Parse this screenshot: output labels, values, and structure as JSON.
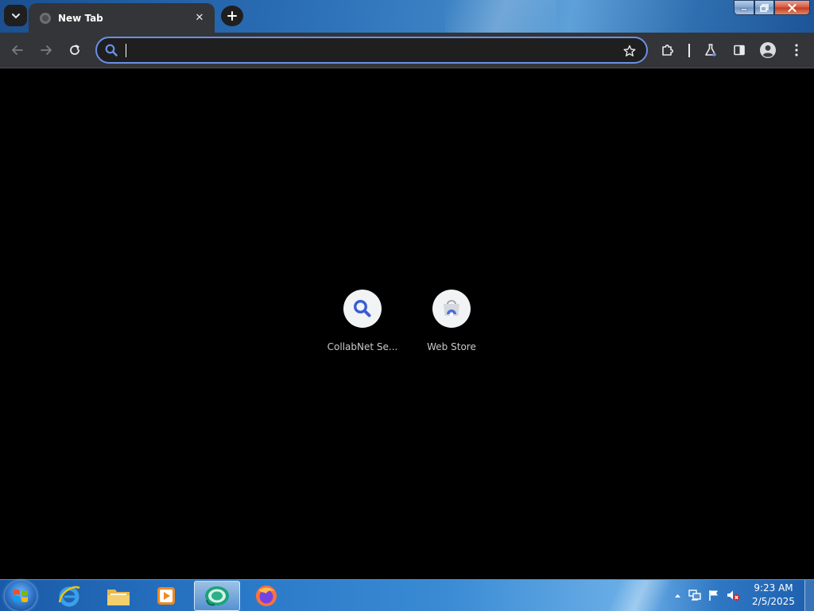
{
  "browser": {
    "tab": {
      "title": "New Tab",
      "close": "✕"
    },
    "new_tab_symbol": "+",
    "omnibox": {
      "value": "",
      "placeholder": ""
    }
  },
  "shortcuts": [
    {
      "label": "CollabNet Se...",
      "icon": "search-icon"
    },
    {
      "label": "Web Store",
      "icon": "web-store-icon"
    }
  ],
  "taskbar": {
    "apps": [
      "internet-explorer-icon",
      "file-explorer-icon",
      "media-player-icon",
      "chrome-icon",
      "firefox-icon"
    ],
    "clock": {
      "time": "9:23 AM",
      "date": "2/5/2025"
    }
  },
  "colors": {
    "omnibox_border": "#6c8fe6",
    "toolbar_bg": "#333538",
    "search_accent": "#3b5bd6"
  }
}
